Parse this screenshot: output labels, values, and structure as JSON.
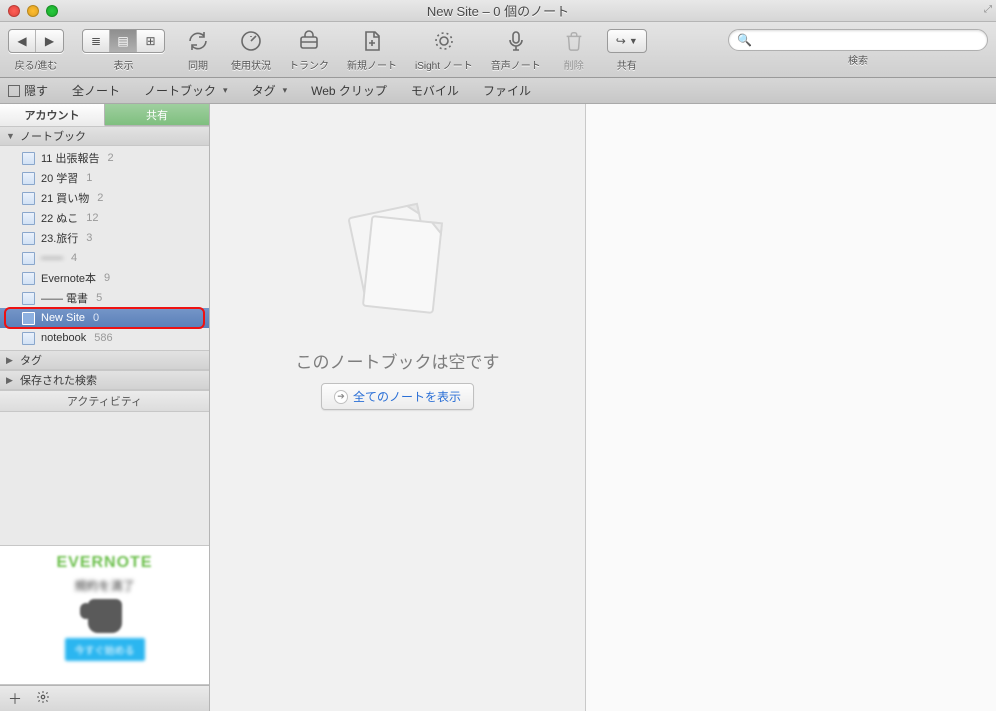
{
  "window": {
    "title": "New Site – 0 個のノート"
  },
  "toolbar": {
    "back_fwd_label": "戻る/進む",
    "view_label": "表示",
    "sync_label": "同期",
    "usage_label": "使用状況",
    "trunk_label": "トランク",
    "newnote_label": "新規ノート",
    "isight_label": "iSight ノート",
    "audio_label": "音声ノート",
    "delete_label": "削除",
    "share_label": "共有",
    "search_label": "検索"
  },
  "favbar": {
    "hide": "隠す",
    "allnotes": "全ノート",
    "notebooks": "ノートブック",
    "tags": "タグ",
    "webclip": "Web クリップ",
    "mobile": "モバイル",
    "file": "ファイル"
  },
  "sidebar": {
    "tab_account": "アカウント",
    "tab_share": "共有",
    "section_notebooks": "ノートブック",
    "section_tags": "タグ",
    "section_saved": "保存された検索",
    "activity": "アクティビティ",
    "notebooks": [
      {
        "name": "11 出張報告",
        "count": "2"
      },
      {
        "name": "20 学習",
        "count": "1"
      },
      {
        "name": "21 買い物",
        "count": "2"
      },
      {
        "name": "22 ぬこ",
        "count": "12"
      },
      {
        "name": "23.旅行",
        "count": "3"
      },
      {
        "name": "——",
        "count": "4",
        "blur": true
      },
      {
        "name": "Evernote本",
        "count": "9"
      },
      {
        "name": "—— 電書",
        "count": "5",
        "blur_partial": true
      },
      {
        "name": "New Site",
        "count": "0",
        "selected": true
      },
      {
        "name": "notebook",
        "count": "586"
      }
    ],
    "ad": {
      "brand": "EVERNOTE",
      "sub": "規約を満了",
      "cta": "今すぐ始める"
    }
  },
  "emptystate": {
    "message": "このノートブックは空です",
    "show_all": "全てのノートを表示"
  }
}
